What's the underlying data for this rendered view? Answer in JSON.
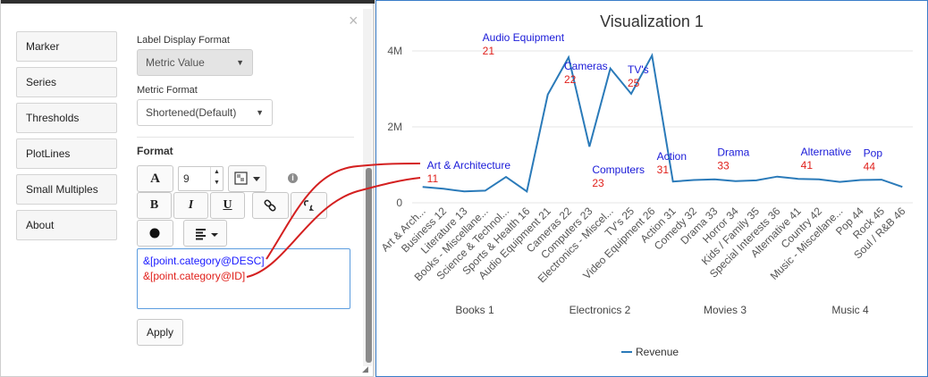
{
  "left_panel": {
    "nav": [
      "Marker",
      "Series",
      "Thresholds",
      "PlotLines",
      "Small Multiples",
      "About"
    ],
    "label_display_format": {
      "label": "Label Display Format",
      "value": "Metric Value"
    },
    "metric_format": {
      "label": "Metric Format",
      "value": "Shortened(Default)"
    },
    "format_heading": "Format",
    "toolbar": {
      "font_label": "A",
      "font_size": "9",
      "bold": "B",
      "italic": "I",
      "underline": "U",
      "info": "i"
    },
    "format_text": [
      "&[point.category@DESC]",
      "&[point.category@ID]"
    ],
    "apply_label": "Apply"
  },
  "chart_data": {
    "type": "line",
    "title": "Visualization 1",
    "yticks": [
      "4M",
      "2M",
      "0"
    ],
    "ylim": [
      0,
      4000000
    ],
    "legend": "Revenue",
    "line_color": "#2a7ab9",
    "categories": [
      "Art & Arch...",
      "Business 12",
      "Literature 13",
      "Books - Miscellane...",
      "Science & Technol...",
      "Sports & Health 16",
      "Audio Equipment 21",
      "Cameras 22",
      "Computers 23",
      "Electronics - Miscel...",
      "TV's 25",
      "Video Equipment 26",
      "Action 31",
      "Comedy 32",
      "Drama 33",
      "Horror 34",
      "Kids / Family 35",
      "Special Interests 36",
      "Alternative 41",
      "Country 42",
      "Music - Miscellane...",
      "Pop 44",
      "Rock 45",
      "Soul / R&B 46"
    ],
    "values": [
      420000,
      370000,
      300000,
      320000,
      680000,
      300000,
      2850000,
      3830000,
      1480000,
      3540000,
      2870000,
      3880000,
      560000,
      600000,
      620000,
      570000,
      590000,
      690000,
      630000,
      620000,
      550000,
      600000,
      610000,
      420000
    ],
    "groups": [
      "Books 1",
      "Electronics 2",
      "Movies 3",
      "Music 4"
    ],
    "point_labels": [
      {
        "desc": "Art & Architecture",
        "id": "11"
      },
      {
        "desc": "Audio Equipment",
        "id": "21"
      },
      {
        "desc": "Cameras",
        "id": "22"
      },
      {
        "desc": "Computers",
        "id": "23"
      },
      {
        "desc": "TV's",
        "id": "25"
      },
      {
        "desc": "Action",
        "id": "31"
      },
      {
        "desc": "Drama",
        "id": "33"
      },
      {
        "desc": "Alternative",
        "id": "41"
      },
      {
        "desc": "Pop",
        "id": "44"
      }
    ]
  }
}
